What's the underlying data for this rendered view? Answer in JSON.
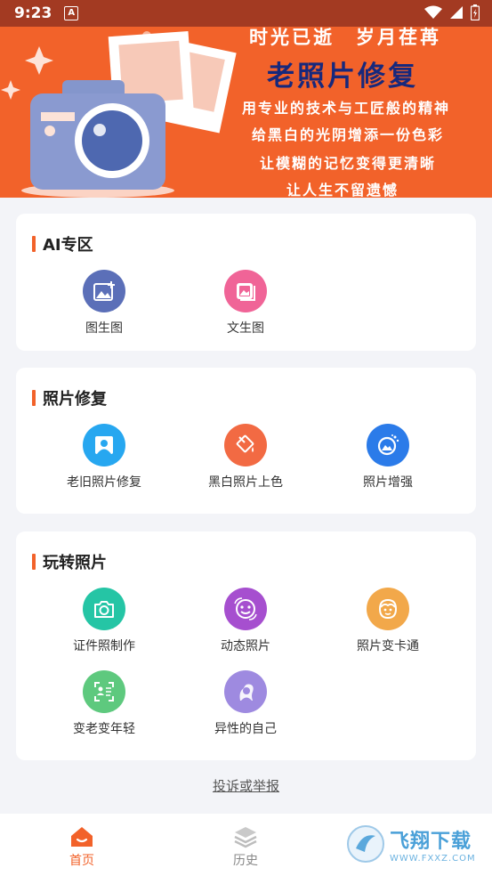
{
  "status_bar": {
    "time": "9:23",
    "notification_badge": "A"
  },
  "banner": {
    "line1": "时光已逝　岁月荏苒",
    "line2": "老照片修复",
    "line3": "用专业的技术与工匠般的精神",
    "line4": "给黑白的光阴增添一份色彩",
    "line5": "让模糊的记忆变得更清晰",
    "line6": "让人生不留遗憾"
  },
  "sections": {
    "ai": {
      "title": "AI专区",
      "items": [
        {
          "label": "图生图",
          "icon": "image-plus-icon",
          "color": "#5b6fb8"
        },
        {
          "label": "文生图",
          "icon": "photo-stack-icon",
          "color": "#f06497"
        }
      ]
    },
    "repair": {
      "title": "照片修复",
      "items": [
        {
          "label": "老旧照片修复",
          "icon": "portrait-icon",
          "color": "#27a7f0"
        },
        {
          "label": "黑白照片上色",
          "icon": "paint-bucket-icon",
          "color": "#f26a43"
        },
        {
          "label": "照片增强",
          "icon": "enhance-photo-icon",
          "color": "#2b7be9"
        }
      ]
    },
    "fun": {
      "title": "玩转照片",
      "items": [
        {
          "label": "证件照制作",
          "icon": "camera-icon",
          "color": "#25c5a5"
        },
        {
          "label": "动态照片",
          "icon": "smiley-face-icon",
          "color": "#a64fcf"
        },
        {
          "label": "照片变卡通",
          "icon": "cartoon-face-icon",
          "color": "#f2a84a"
        },
        {
          "label": "变老变年轻",
          "icon": "face-scan-icon",
          "color": "#5ec97e"
        },
        {
          "label": "异性的自己",
          "icon": "gender-swap-icon",
          "color": "#9e8ae0"
        }
      ]
    }
  },
  "report_link": "投诉或举报",
  "bottom_nav": {
    "home": "首页",
    "history": "历史",
    "active_color": "#f2622a",
    "inactive_color": "#888888"
  },
  "watermark": {
    "title": "飞翔下载",
    "subtitle": "WWW.FXXZ.COM"
  }
}
